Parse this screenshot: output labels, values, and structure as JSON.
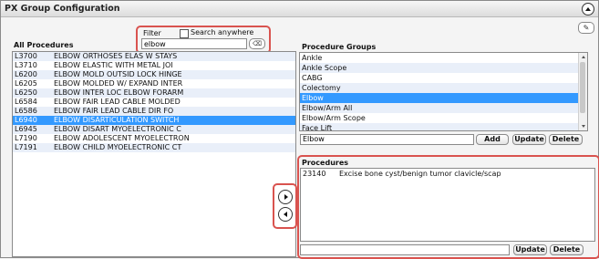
{
  "header": {
    "title": "PX Group Configuration"
  },
  "filter": {
    "label": "Filter",
    "search_anywhere_label": "Search anywhere",
    "value": "elbow",
    "search_anywhere_checked": false
  },
  "all_procedures": {
    "label": "All Procedures",
    "selected_index": 7,
    "rows": [
      {
        "code": "L3700",
        "desc": "ELBOW ORTHOSES ELAS W STAYS"
      },
      {
        "code": "L3710",
        "desc": "ELBOW ELASTIC WITH METAL JOI"
      },
      {
        "code": "L6200",
        "desc": "ELBOW MOLD OUTSID LOCK HINGE"
      },
      {
        "code": "L6205",
        "desc": "ELBOW MOLDED W/ EXPAND INTER"
      },
      {
        "code": "L6250",
        "desc": "ELBOW INTER LOC ELBOW FORARM"
      },
      {
        "code": "L6584",
        "desc": "ELBOW FAIR LEAD CABLE MOLDED"
      },
      {
        "code": "L6586",
        "desc": "ELBOW FAIR LEAD CABLE DIR FO"
      },
      {
        "code": "L6940",
        "desc": "ELBOW DISARTICULATION SWITCH"
      },
      {
        "code": "L6945",
        "desc": "ELBOW DISART MYOELECTRONIC C"
      },
      {
        "code": "L7190",
        "desc": "ELBOW ADOLESCENT MYOELECTRON"
      },
      {
        "code": "L7191",
        "desc": "ELBOW CHILD MYOELECTRONIC CT"
      }
    ]
  },
  "procedure_groups": {
    "label": "Procedure Groups",
    "selected_index": 4,
    "items": [
      "Ankle",
      "Ankle Scope",
      "CABG",
      "Colectomy",
      "Elbow",
      "Elbow/Arm All",
      "Elbow/Arm Scope",
      "Face Lift"
    ],
    "name_value": "Elbow",
    "add_label": "Add",
    "update_label": "Update",
    "delete_label": "Delete"
  },
  "procedures": {
    "label": "Procedures",
    "rows": [
      {
        "code": "23140",
        "desc": "Excise bone cyst/benign tumor clavicle/scap"
      }
    ],
    "input_value": "",
    "update_label": "Update",
    "delete_label": "Delete"
  },
  "icons": {
    "collapse": "chevron-up-circle-icon",
    "edit": "pencil-icon",
    "clear_filter": "eraser-icon",
    "add_to_group": "arrow-right-circle-icon",
    "remove_from_group": "arrow-left-circle-icon"
  },
  "colors": {
    "selection": "#3399ff",
    "highlight_border": "#d9534f",
    "alt_row": "#e9eff9"
  }
}
